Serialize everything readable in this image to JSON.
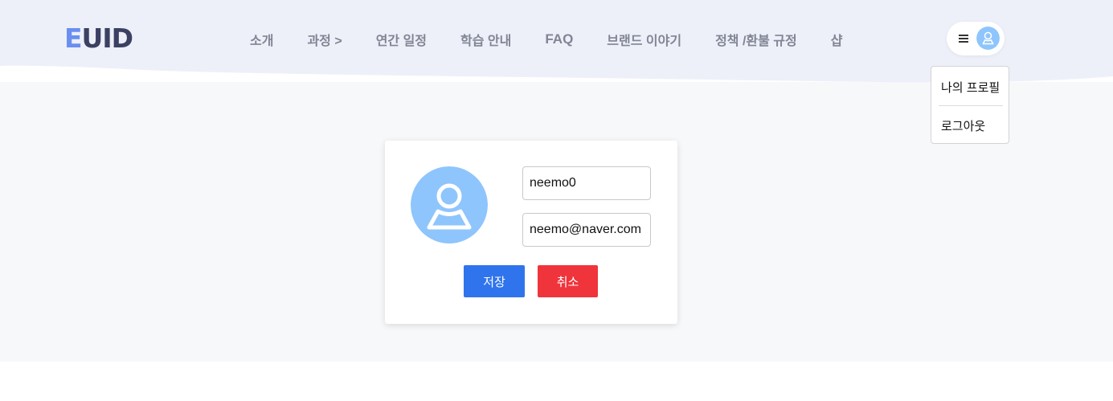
{
  "header": {
    "logo": {
      "part1": "E",
      "part2": "UID"
    },
    "nav": [
      {
        "label": "소개"
      },
      {
        "label": "과정 >"
      },
      {
        "label": "연간 일정"
      },
      {
        "label": "학습 안내"
      },
      {
        "label": "FAQ"
      },
      {
        "label": "브랜드 이야기"
      },
      {
        "label": "정책 /환불 규정"
      },
      {
        "label": "샵"
      }
    ],
    "menu_icon": "hamburger-icon",
    "avatar_icon": "user-avatar-icon"
  },
  "dropdown": {
    "items": [
      {
        "label": "나의 프로필"
      },
      {
        "label": "로그아웃"
      }
    ]
  },
  "profile": {
    "avatar_icon": "user-avatar-icon",
    "username": "neemo0",
    "email": "neemo@naver.com",
    "save_label": "저장",
    "cancel_label": "취소"
  },
  "colors": {
    "header_bg": "#edf0f8",
    "page_bg": "#f7f8fa",
    "logo_accent": "#6a8ff0",
    "logo_main": "#3c4063",
    "nav_text": "#818594",
    "avatar_fill": "#8ec5fc",
    "save_button": "#2f74ec",
    "cancel_button": "#f0343c"
  }
}
